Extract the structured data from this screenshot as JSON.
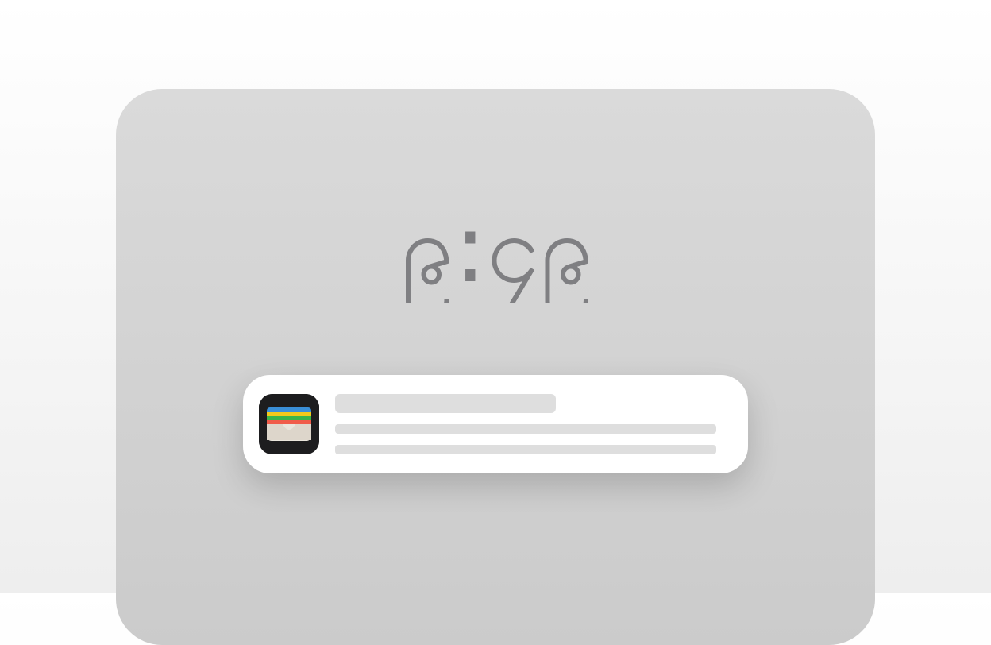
{
  "lock_screen": {
    "time": "၉:၄၉",
    "time_color": "#7f7f82"
  },
  "notification": {
    "app_icon": "wallet-icon",
    "icon_background": "#1d1d1f",
    "placeholder_color": "#dedede"
  }
}
